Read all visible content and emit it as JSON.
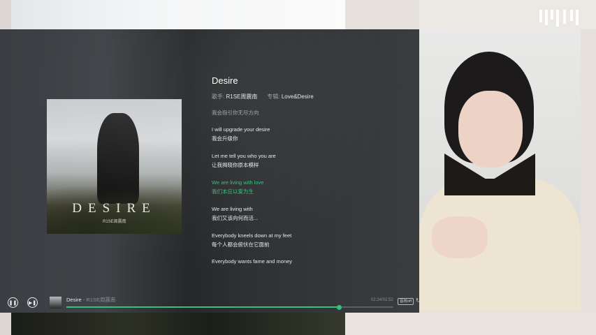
{
  "album": {
    "cover_title": "DESIRE",
    "cover_artist": "R1SE周震南"
  },
  "song": {
    "title": "Desire",
    "singer_label": "歌手:",
    "singer": "R1SE周震南",
    "album_label": "专辑:",
    "album": "Love&Desire"
  },
  "lyrics": [
    {
      "text": "我会指引你无尽方向",
      "state": "faded"
    },
    {
      "text": "I will upgrade your desire",
      "state": "normal"
    },
    {
      "text": "我会升级你",
      "state": "normal"
    },
    {
      "text": "Let me tell you who you are",
      "state": "normal"
    },
    {
      "text": "让我揭晓你原本模样",
      "state": "normal"
    },
    {
      "text": "We are living with love",
      "state": "active"
    },
    {
      "text": "我们本应以爱为生",
      "state": "active"
    },
    {
      "text": "We are living with",
      "state": "normal"
    },
    {
      "text": "我们又该向何而活...",
      "state": "normal"
    },
    {
      "text": "Everybody kneels down at my feet",
      "state": "normal"
    },
    {
      "text": "每个人都会俯伏在它面前",
      "state": "normal"
    },
    {
      "text": "Everybody wants fame and money",
      "state": "normal"
    }
  ],
  "playbar": {
    "play_pause_icon": "pause-icon",
    "next_icon": "next-track-icon",
    "title": "Desire",
    "separator": " - ",
    "artist": "R1SE周震南",
    "time": "02:24/02:52",
    "progress": 0.834,
    "quality": "音效off",
    "loop_icon": "loop-icon"
  },
  "colors": {
    "accent": "#31c27c"
  }
}
